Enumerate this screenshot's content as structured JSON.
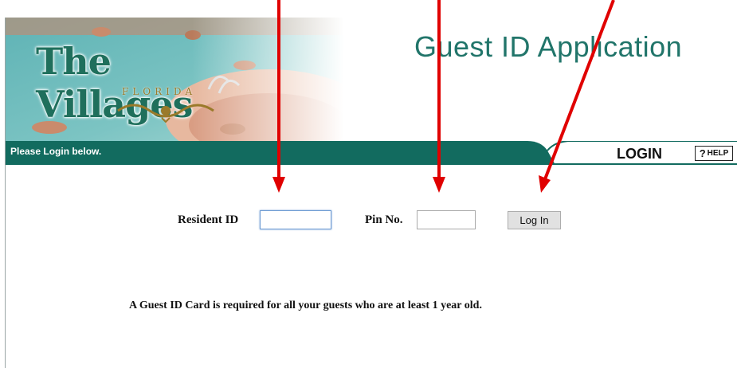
{
  "header": {
    "logo_text": "The Villages",
    "logo_subtext": "FLORIDA",
    "app_title": "Guest ID Application"
  },
  "band": {
    "message": "Please Login below.",
    "heading": "LOGIN",
    "help_label": "HELP",
    "help_glyph": "?"
  },
  "form": {
    "resident_id_label": "Resident ID",
    "resident_id_value": "",
    "pin_label": "Pin No.",
    "pin_value": "",
    "login_button": "Log In"
  },
  "notice": "A Guest ID Card is required for all your guests who are at least 1 year old.",
  "colors": {
    "brand_teal": "#21756a",
    "band_teal": "#126b5f",
    "annotation_red": "#e00000"
  }
}
